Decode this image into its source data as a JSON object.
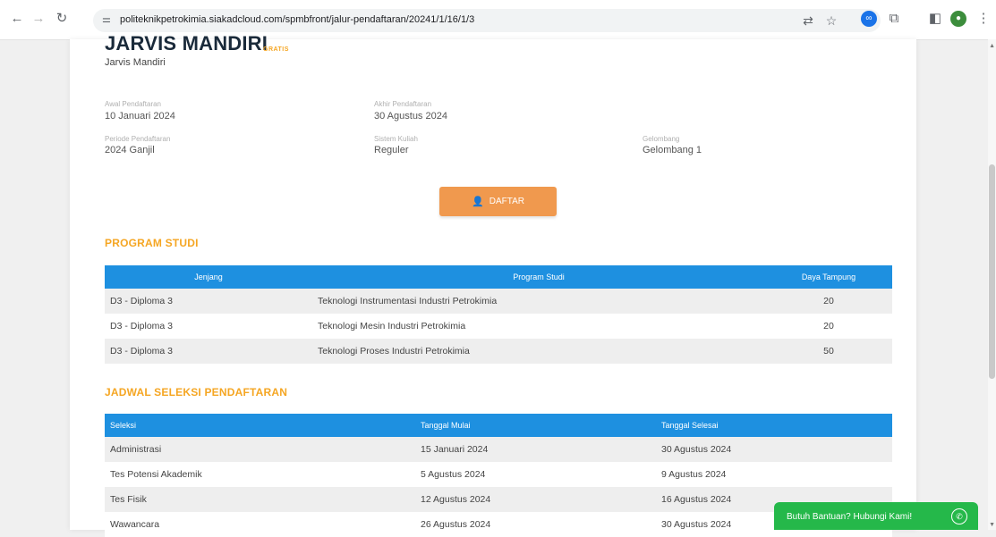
{
  "browser": {
    "url": "politeknikpetrokimia.siakadcloud.com/spmbfront/jalur-pendaftaran/20241/1/16/1/3",
    "icons": [
      "back-icon",
      "forward-icon",
      "reload-icon",
      "site-info-icon",
      "translate-icon",
      "star-icon",
      "extension-icon",
      "extensions-puzzle-icon",
      "side-panel-icon",
      "profile-icon",
      "menu-icon"
    ]
  },
  "path": {
    "title": "JARVIS MANDIRI",
    "badge": "GRATIS",
    "subtitle": "Jarvis Mandiri"
  },
  "info": {
    "start_label": "Awal Pendaftaran",
    "start_value": "10 Januari 2024",
    "end_label": "Akhir Pendaftaran",
    "end_value": "30 Agustus 2024",
    "period_label": "Periode Pendaftaran",
    "period_value": "2024 Ganjil",
    "system_label": "Sistem Kuliah",
    "system_value": "Reguler",
    "wave_label": "Gelombang",
    "wave_value": "Gelombang 1"
  },
  "daftar_button": {
    "label": "DAFTAR",
    "icon": "add-user-icon"
  },
  "program_studi": {
    "title": "PROGRAM STUDI",
    "headers": [
      "Jenjang",
      "Program Studi",
      "Daya Tampung"
    ],
    "rows": [
      [
        "D3 - Diploma 3",
        "Teknologi Instrumentasi Industri Petrokimia",
        "20"
      ],
      [
        "D3 - Diploma 3",
        "Teknologi Mesin Industri Petrokimia",
        "20"
      ],
      [
        "D3 - Diploma 3",
        "Teknologi Proses Industri Petrokimia",
        "50"
      ]
    ]
  },
  "jadwal": {
    "title": "JADWAL SELEKSI PENDAFTARAN",
    "headers": [
      "Seleksi",
      "Tanggal Mulai",
      "Tanggal Selesai"
    ],
    "rows": [
      [
        "Administrasi",
        "15 Januari 2024",
        "30 Agustus 2024"
      ],
      [
        "Tes Potensi Akademik",
        "5 Agustus 2024",
        "9 Agustus 2024"
      ],
      [
        "Tes Fisik",
        "12 Agustus 2024",
        "16 Agustus 2024"
      ],
      [
        "Wawancara",
        "26 Agustus 2024",
        "30 Agustus 2024"
      ]
    ]
  },
  "help": {
    "label": "Butuh Bantuan? Hubungi Kami!",
    "icon": "whatsapp-icon"
  },
  "colors": {
    "accent": "#f5a623",
    "table_header": "#1e90e0",
    "button": "#f0994e",
    "help": "#25b84a"
  }
}
